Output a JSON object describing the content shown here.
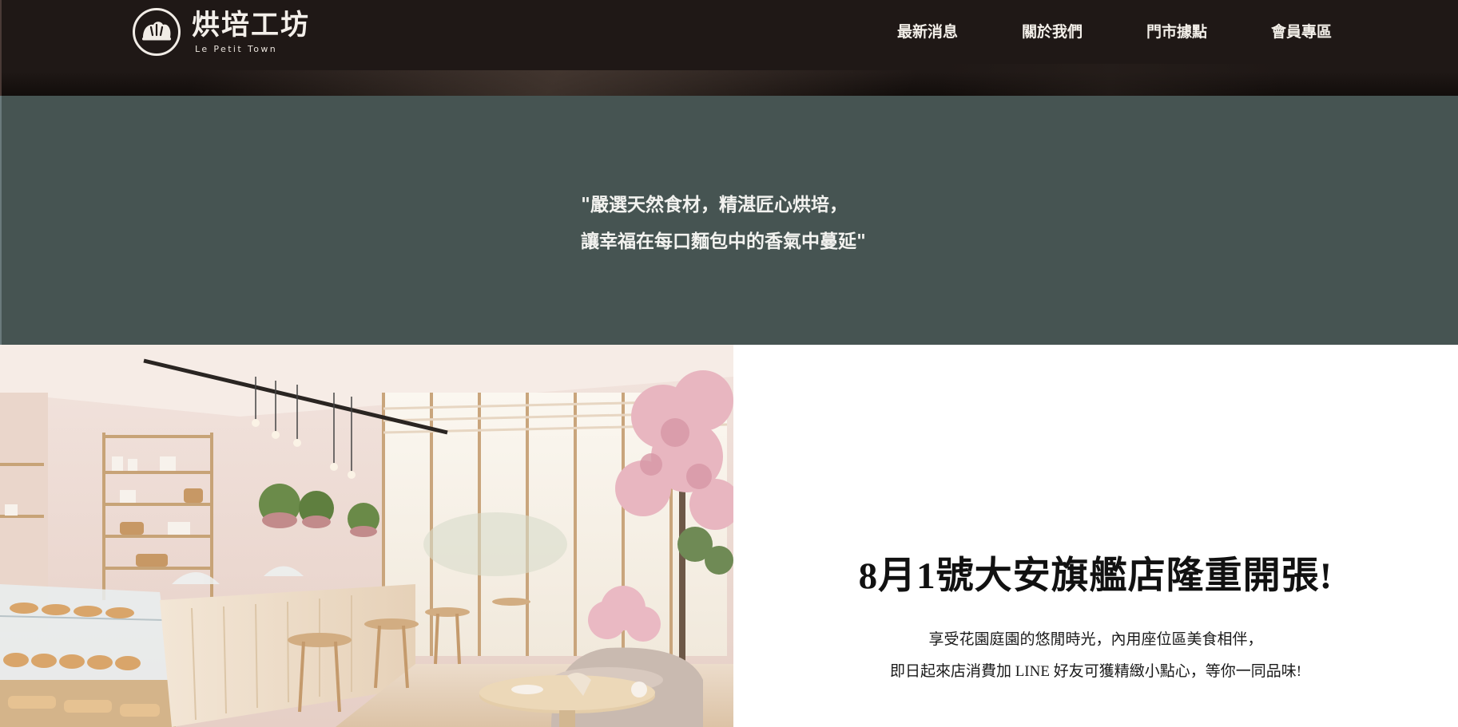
{
  "header": {
    "logo_title": "烘培工坊",
    "logo_subtitle": "Le Petit Town",
    "logo_icon": "bread-icon",
    "nav": [
      {
        "label": "最新消息"
      },
      {
        "label": "關於我們"
      },
      {
        "label": "門市據點"
      },
      {
        "label": "會員專區"
      }
    ]
  },
  "quote": {
    "line1": "\"嚴選天然食材，精湛匠心烘培，",
    "line2": "讓幸福在每口麵包中的香氣中蔓延\""
  },
  "feature": {
    "image_alt": "bakery-cafe-interior",
    "title": "8月1號大安旗艦店隆重開張!",
    "line1": "享受花園庭園的悠閒時光，內用座位區美食相伴，",
    "line2": "即日起來店消費加 LINE 好友可獲精緻小點心，等你一同品味!"
  },
  "colors": {
    "header_bg": "#1f1816",
    "quote_bg": "#465452",
    "header_text": "#f4f0ea",
    "feature_bg": "#ffffff"
  }
}
